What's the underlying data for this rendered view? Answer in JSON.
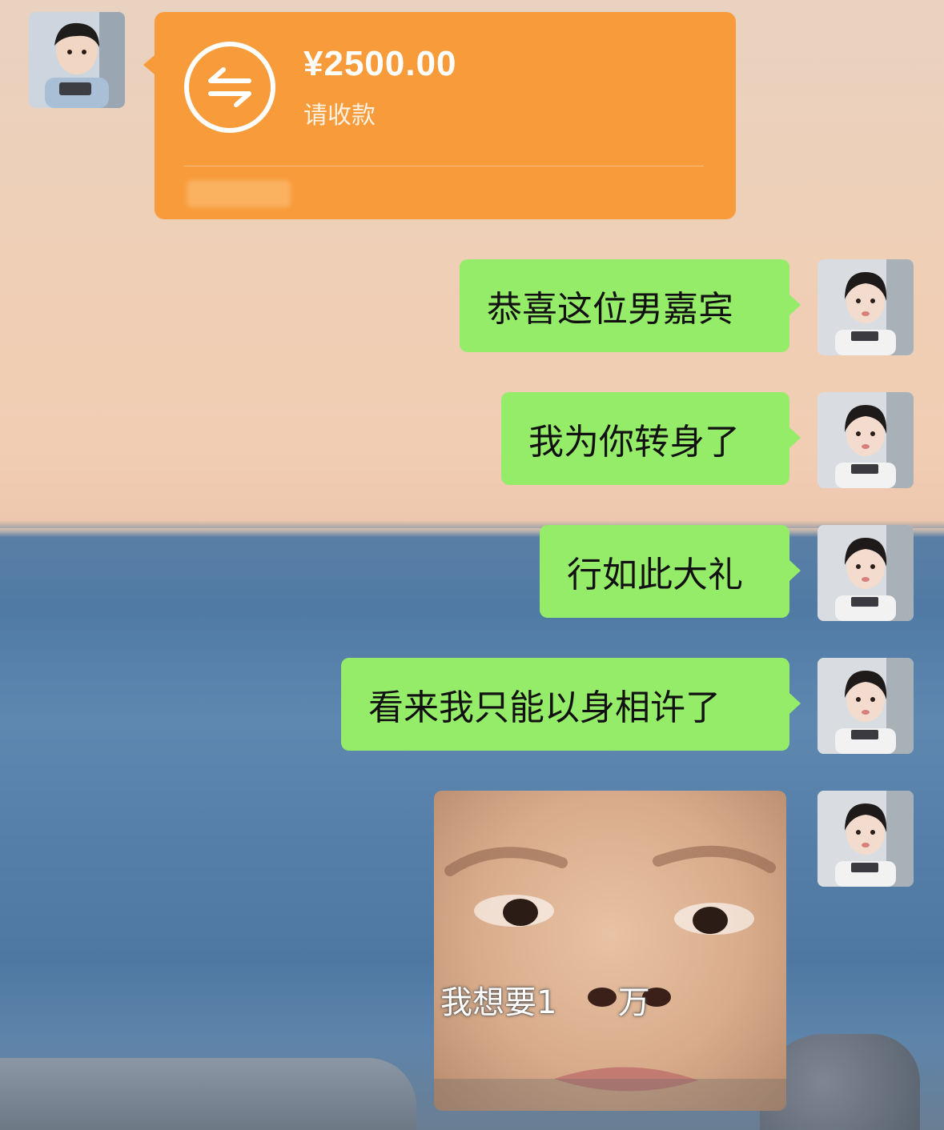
{
  "transfer": {
    "amount": "¥2500.00",
    "status": "请收款",
    "icon": "transfer-arrows-icon",
    "color": "#f89b3a"
  },
  "messages": [
    {
      "text": "恭喜这位男嘉宾"
    },
    {
      "text": "我为你转身了"
    },
    {
      "text": "行如此大礼"
    },
    {
      "text": "看来我只能以身相许了"
    }
  ],
  "sticker": {
    "caption": "我想要1      万"
  },
  "colors": {
    "bubble_green": "#95ec69",
    "transfer_orange": "#f89b3a"
  }
}
